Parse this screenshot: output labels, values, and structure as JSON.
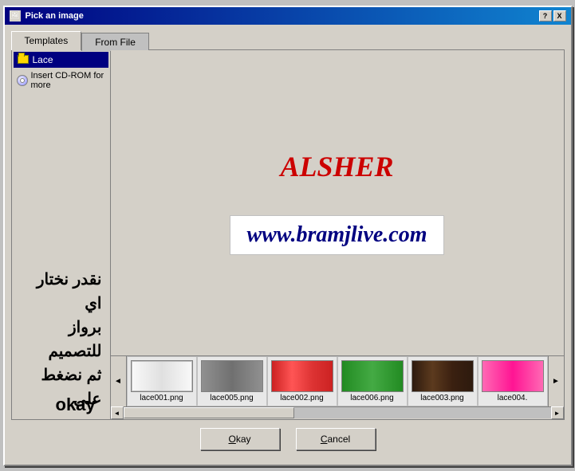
{
  "dialog": {
    "title": "Pick an image",
    "title_icon": "🖼",
    "help_btn": "?",
    "close_btn": "X"
  },
  "tabs": [
    {
      "label": "Templates",
      "active": true
    },
    {
      "label": "From File",
      "active": false
    }
  ],
  "tree": {
    "folder": "Lace",
    "cd_label": "Insert CD-ROM for more"
  },
  "preview": {
    "alsher": "ALSHER",
    "website": "www.bramjlive.com"
  },
  "arabic_text": "نقدر نختار اي\nبرواز للتصميم\nثم نضغط على",
  "okay_label": "okay",
  "thumbnails": [
    {
      "label": "lace001.png",
      "style": "white"
    },
    {
      "label": "lace005.png",
      "style": "gray"
    },
    {
      "label": "lace002.png",
      "style": "red"
    },
    {
      "label": "lace006.png",
      "style": "green"
    },
    {
      "label": "lace003.png",
      "style": "dark"
    },
    {
      "label": "lace004.",
      "style": "pink"
    }
  ],
  "buttons": {
    "okay": "Okay",
    "okay_underline": "O",
    "cancel": "Cancel",
    "cancel_underline": "C"
  }
}
